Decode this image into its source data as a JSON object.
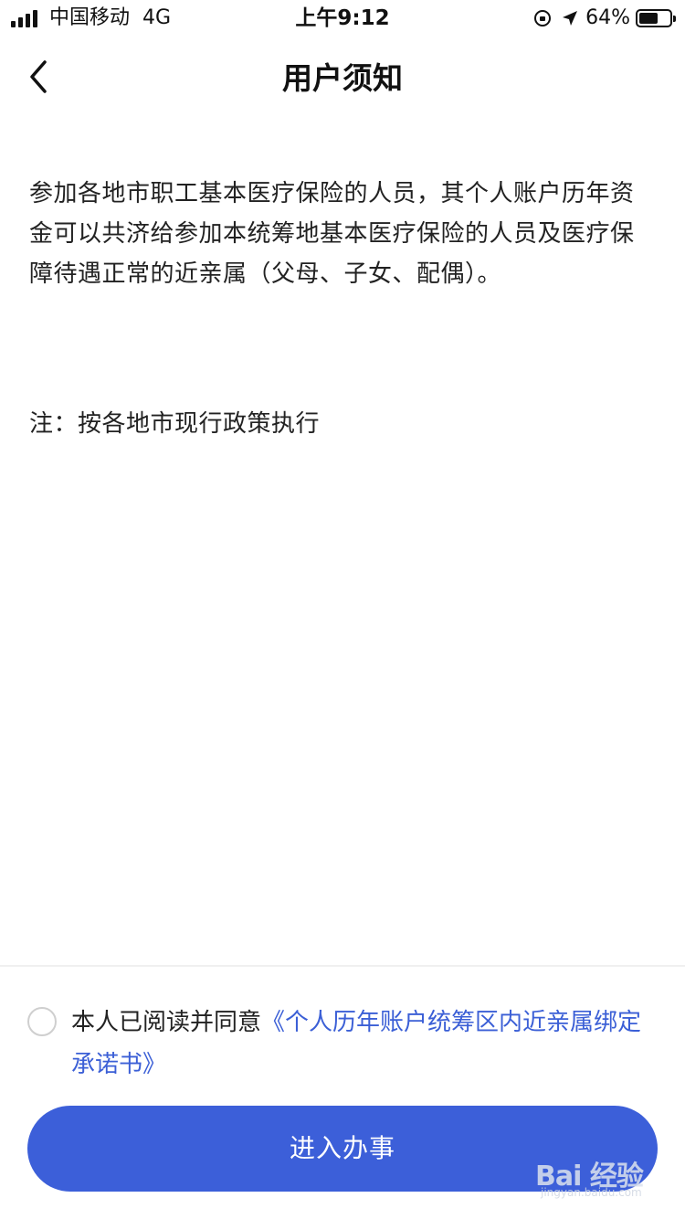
{
  "status_bar": {
    "carrier": "中国移动",
    "network": "4G",
    "time": "上午9:12",
    "battery_percent": "64%",
    "battery_level": 0.64,
    "icons": [
      "signal-icon",
      "orientation-lock-icon",
      "location-arrow-icon",
      "battery-icon"
    ]
  },
  "nav": {
    "title": "用户须知",
    "back_icon": "chevron-left-icon"
  },
  "content": {
    "paragraph": "参加各地市职工基本医疗保险的人员，其个人账户历年资金可以共济给参加本统筹地基本医疗保险的人员及医疗保障待遇正常的近亲属（父母、子女、配偶）。",
    "note": "注：按各地市现行政策执行"
  },
  "agreement": {
    "prefix": "本人已阅读并同意",
    "link_text": "《个人历年账户统筹区内近亲属绑定承诺书》",
    "checked": false
  },
  "action": {
    "proceed_label": "进入办事"
  },
  "watermark": {
    "text": "Bai 经验",
    "sub": "jingyan.baidu.com"
  },
  "colors": {
    "accent": "#3c5fd9",
    "link": "#3b5fd6",
    "text": "#222222"
  }
}
